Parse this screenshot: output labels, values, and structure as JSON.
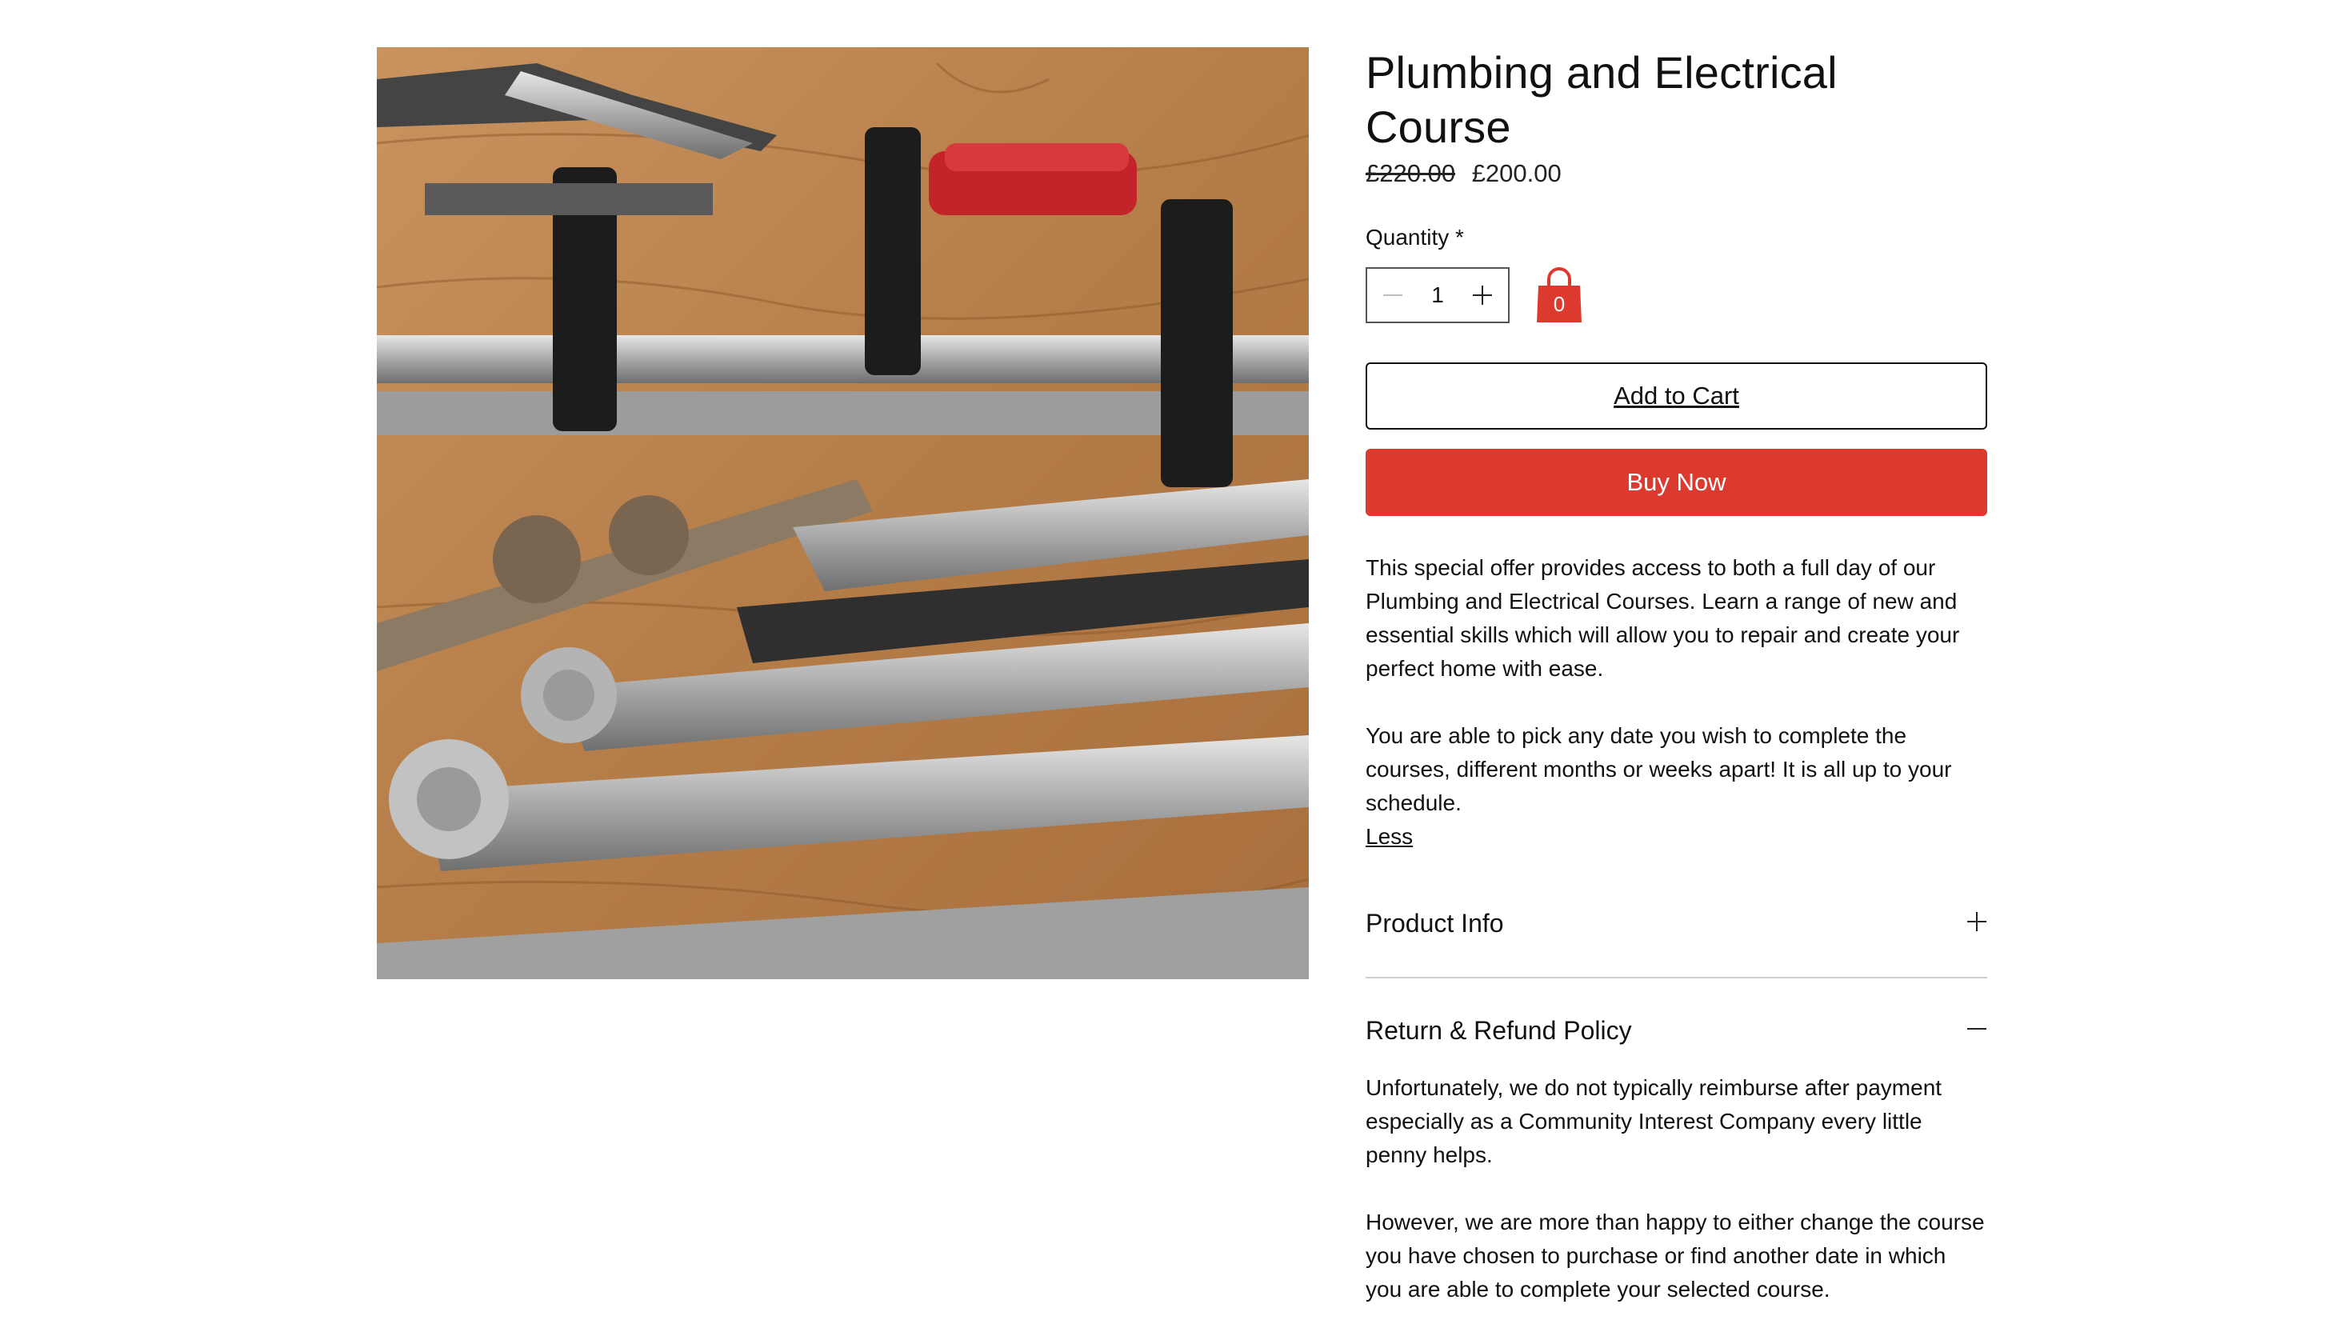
{
  "product": {
    "title": "Plumbing and Electrical Course",
    "old_price": "£220.00",
    "price": "£200.00",
    "quantity_label": "Quantity *",
    "quantity_value": "1",
    "cart_count": "0",
    "add_to_cart_label": "Add to Cart",
    "buy_now_label": "Buy Now",
    "description": [
      "This special offer provides access to both a full day of our Plumbing and Electrical Courses. Learn a range of new and essential skills which will allow you to repair and create your perfect home with ease.",
      "You are able to pick any date you wish to complete the courses, different months or weeks apart! It is all up to your schedule."
    ],
    "less_label": "Less"
  },
  "accordion": {
    "product_info_label": "Product Info",
    "refund_label": "Return & Refund Policy",
    "refund_text": [
      "Unfortunately, we do not typically reimburse after payment especially as a Community Interest Company every little penny helps.",
      "However, we are more than happy to either change the course you have chosen to purchase or find another date in which you are able to complete your selected course."
    ]
  },
  "colors": {
    "accent": "#dc3a2e",
    "text": "#111111",
    "divider": "#cfcfcf"
  },
  "icons": {
    "minus": "minus-icon",
    "plus": "plus-icon",
    "cart": "shopping-bag-icon",
    "expand": "plus-icon",
    "collapse": "minus-icon"
  }
}
